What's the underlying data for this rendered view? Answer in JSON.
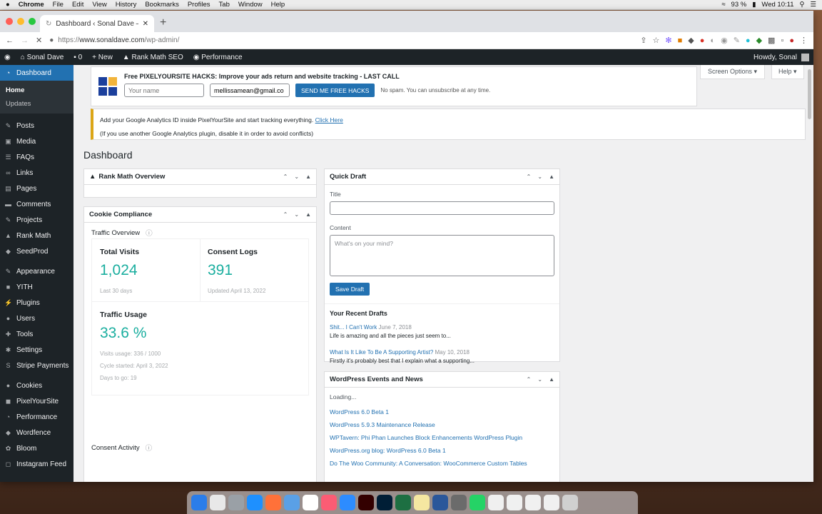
{
  "mac_menu": {
    "apple": "",
    "app": "Chrome",
    "items": [
      "File",
      "Edit",
      "View",
      "History",
      "Bookmarks",
      "Profiles",
      "Tab",
      "Window",
      "Help"
    ],
    "battery": "93 %",
    "clock": "Wed 10:11"
  },
  "browser": {
    "tab_title": "Dashboard ‹ Sonal Dave — W...",
    "url_scheme": "https://",
    "url_host": "www.sonaldave.com",
    "url_path": "/wp-admin/"
  },
  "adminbar": {
    "site": "Sonal Dave",
    "comments": "0",
    "new": "New",
    "rankmath": "Rank Math SEO",
    "performance": "Performance",
    "howdy": "Howdy, Sonal"
  },
  "sidebar": {
    "dashboard": "Dashboard",
    "home": "Home",
    "updates": "Updates",
    "items": [
      {
        "label": "Posts",
        "icon": "pin-icon"
      },
      {
        "label": "Media",
        "icon": "media-icon"
      },
      {
        "label": "FAQs",
        "icon": "faq-icon"
      },
      {
        "label": "Links",
        "icon": "link-icon"
      },
      {
        "label": "Pages",
        "icon": "page-icon"
      },
      {
        "label": "Comments",
        "icon": "comment-icon"
      },
      {
        "label": "Projects",
        "icon": "pin-icon"
      },
      {
        "label": "Rank Math",
        "icon": "chart-icon"
      },
      {
        "label": "SeedProd",
        "icon": "seed-icon"
      },
      {
        "label": "Appearance",
        "icon": "brush-icon"
      },
      {
        "label": "YITH",
        "icon": "yith-icon"
      },
      {
        "label": "Plugins",
        "icon": "plug-icon"
      },
      {
        "label": "Users",
        "icon": "user-icon"
      },
      {
        "label": "Tools",
        "icon": "wrench-icon"
      },
      {
        "label": "Settings",
        "icon": "settings-icon"
      },
      {
        "label": "Stripe Payments",
        "icon": "stripe-icon"
      },
      {
        "label": "Cookies",
        "icon": "cookie-icon"
      },
      {
        "label": "PixelYourSite",
        "icon": "pixel-icon"
      },
      {
        "label": "Performance",
        "icon": "gauge-icon"
      },
      {
        "label": "Wordfence",
        "icon": "shield-icon"
      },
      {
        "label": "Bloom",
        "icon": "bloom-icon"
      },
      {
        "label": "Instagram Feed",
        "icon": "instagram-icon"
      }
    ]
  },
  "notice_pixel": {
    "title": "Free PIXELYOURSITE HACKS: Improve your ads return and website tracking - LAST CALL",
    "name_placeholder": "Your name",
    "email_value": "mellissamean@gmail.co",
    "button": "SEND ME FREE HACKS",
    "note": "No spam. You can unsubscribe at any time."
  },
  "screen_options": "Screen Options ▾",
  "help": "Help ▾",
  "notice_ga": {
    "line1": "Add your Google Analytics ID inside PixelYourSite and start tracking everything.",
    "link": "Click Here",
    "line2": "(If you use another Google Analytics plugin, disable it in order to avoid conflicts)"
  },
  "page_title": "Dashboard",
  "rankmath_box": {
    "title": "Rank Math Overview"
  },
  "cookie_box": {
    "title": "Cookie Compliance",
    "traffic_overview": "Traffic Overview",
    "total_visits_label": "Total Visits",
    "total_visits": "1,024",
    "total_visits_sub": "Last 30 days",
    "consent_logs_label": "Consent Logs",
    "consent_logs": "391",
    "consent_logs_sub": "Updated April 13, 2022",
    "traffic_usage_label": "Traffic Usage",
    "traffic_usage": "33.6 %",
    "visits_usage": "Visits usage: 336 / 1000",
    "cycle_started": "Cycle started: April 3, 2022",
    "days_to_go": "Days to go: 19",
    "consent_activity": "Consent Activity"
  },
  "quick_draft": {
    "title": "Quick Draft",
    "title_label": "Title",
    "content_label": "Content",
    "content_placeholder": "What's on your mind?",
    "save": "Save Draft",
    "recent": "Your Recent Drafts",
    "drafts": [
      {
        "title": "Shit... I Can't Work",
        "date": "June 7, 2018",
        "excerpt": "Life is amazing and all the pieces just seem to..."
      },
      {
        "title": "What Is It Like To Be A Supporting Artist?",
        "date": "May 10, 2018",
        "excerpt": "Firstly it's probably best that I explain what a supporting..."
      }
    ]
  },
  "events_box": {
    "title": "WordPress Events and News",
    "loading": "Loading...",
    "news": [
      "WordPress 6.0 Beta 1",
      "WordPress 5.9.3 Maintenance Release",
      "WPTavern: Phi Phan Launches Block Enhancements WordPress Plugin",
      "WordPress.org blog: WordPress 6.0 Beta 1",
      "Do The Woo Community: A Conversation: WooCommerce Custom Tables"
    ]
  },
  "colors": {
    "admin_dark": "#1d2327",
    "accent_blue": "#2271b1",
    "stat_teal": "#1aae9f",
    "notice_yellow": "#dba617"
  }
}
